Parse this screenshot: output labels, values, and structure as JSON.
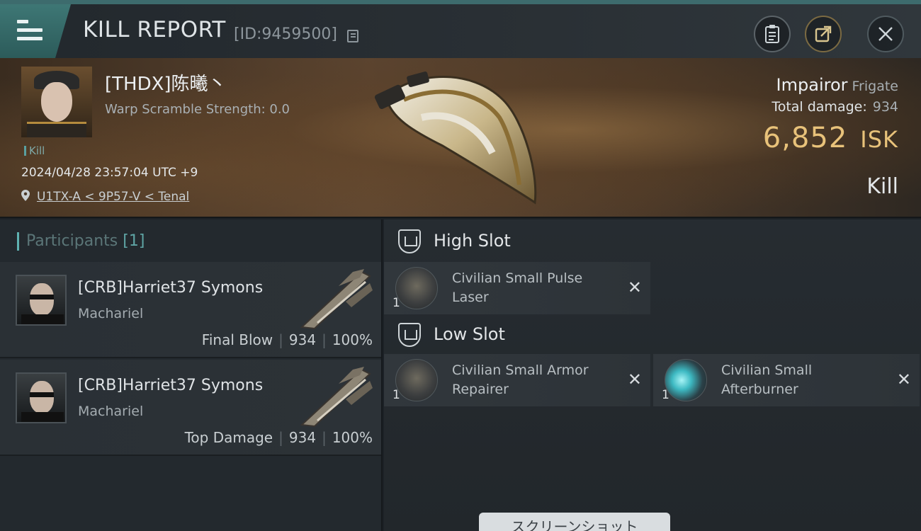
{
  "header": {
    "title": "KILL REPORT",
    "report_id": "[ID:9459500]"
  },
  "victim": {
    "name": "[THDX]陈曦丶",
    "warp_scramble": "Warp Scramble Strength: 0.0",
    "kill_tag": "Kill",
    "datetime": "2024/04/28 23:57:04 UTC +9",
    "location": "U1TX-A < 9P57-V < Tenal",
    "ship_name": "Impairor",
    "ship_class": "Frigate",
    "total_damage_label": "Total damage:",
    "total_damage_value": "934",
    "isk_value": "6,852",
    "isk_unit": "ISK",
    "kill_type": "Kill"
  },
  "participants": {
    "title": "Participants",
    "count": "[1]",
    "rows": [
      {
        "name": "[CRB]Harriet37 Symons",
        "ship": "Machariel",
        "role": "Final Blow",
        "damage": "934",
        "percent": "100%"
      },
      {
        "name": "[CRB]Harriet37 Symons",
        "ship": "Machariel",
        "role": "Top Damage",
        "damage": "934",
        "percent": "100%"
      }
    ]
  },
  "slots": {
    "high_title": "High Slot",
    "low_title": "Low Slot",
    "high_modules": [
      {
        "qty": "1",
        "line1": "Civilian Small Pulse",
        "line2": "Laser",
        "icon": "pulse-laser-icon"
      }
    ],
    "low_modules": [
      {
        "qty": "1",
        "line1": "Civilian Small Armor",
        "line2": "Repairer",
        "icon": "armor-repairer-icon"
      },
      {
        "qty": "1",
        "line1": "Civilian Small",
        "line2": "Afterburner",
        "icon": "afterburner-icon"
      }
    ]
  },
  "screenshot_tab": "スクリーンショット"
}
